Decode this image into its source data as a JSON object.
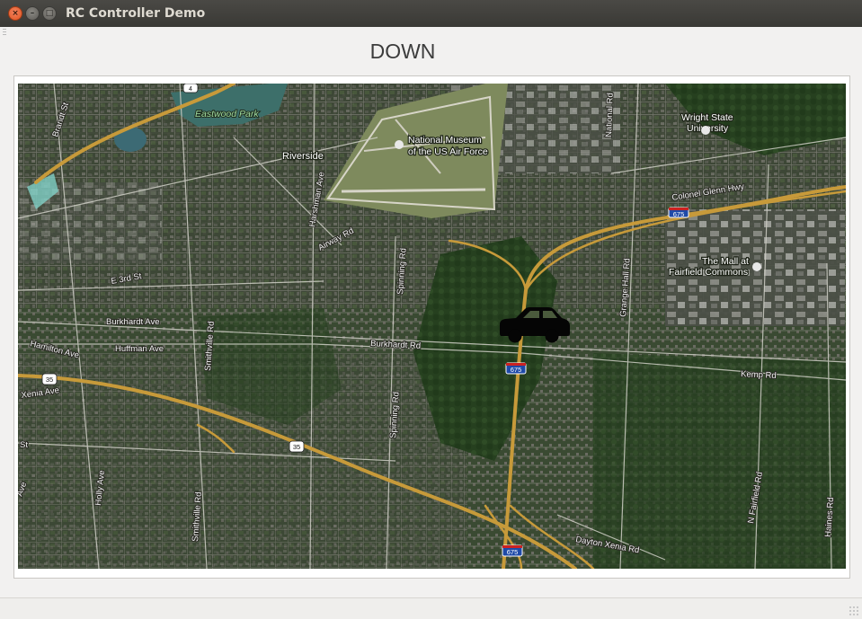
{
  "window": {
    "title": "RC Controller Demo",
    "buttons": {
      "close": "×",
      "minimize": "–",
      "maximize": "□"
    }
  },
  "status": {
    "direction": "DOWN"
  },
  "map": {
    "car_icon": "car-icon",
    "labels": {
      "eastwood_park": "Eastwood Park",
      "museum_line1": "National Museum",
      "museum_line2": "of the US Air Force",
      "wright_line1": "Wright State",
      "wright_line2": "University",
      "mall_line1": "The Mall at",
      "mall_line2": "Fairfield Commons",
      "riverside": "Riverside"
    },
    "roads": {
      "brandt": "Brandt St",
      "harshman": "Harshman Ave",
      "airway": "Airway Rd",
      "e3rd": "E 3rd St",
      "burkhardt_ave": "Burkhardt Ave",
      "huffman": "Huffman Ave",
      "hamilton": "Hamilton Ave",
      "xenia": "Xenia Ave",
      "smithville1": "Smithville Rd",
      "smithville2": "Smithville Rd",
      "spinning1": "Spinning Rd",
      "spinning2": "Spinning Rd",
      "burkhardt_rd": "Burkhardt Rd",
      "kemp": "Kemp Rd",
      "national": "National Rd",
      "grange": "Grange Hall Rd",
      "colonel": "Colonel Glenn Hwy",
      "dayton_xenia": "Dayton Xenia Rd",
      "holly": "Holly Ave",
      "nfairfield": "N Fairfield Rd",
      "haines": "Haines Rd",
      "st": "St",
      "ave": "Ave"
    },
    "shields": {
      "i675_top": "675",
      "i675_mid": "675",
      "i675_bottom": "675",
      "us35_left": "35",
      "us35_mid": "35",
      "us4": "4"
    },
    "colors": {
      "highway": "#c79a3a",
      "road": "#cfcfc6",
      "water": "#3d6f6a"
    }
  }
}
